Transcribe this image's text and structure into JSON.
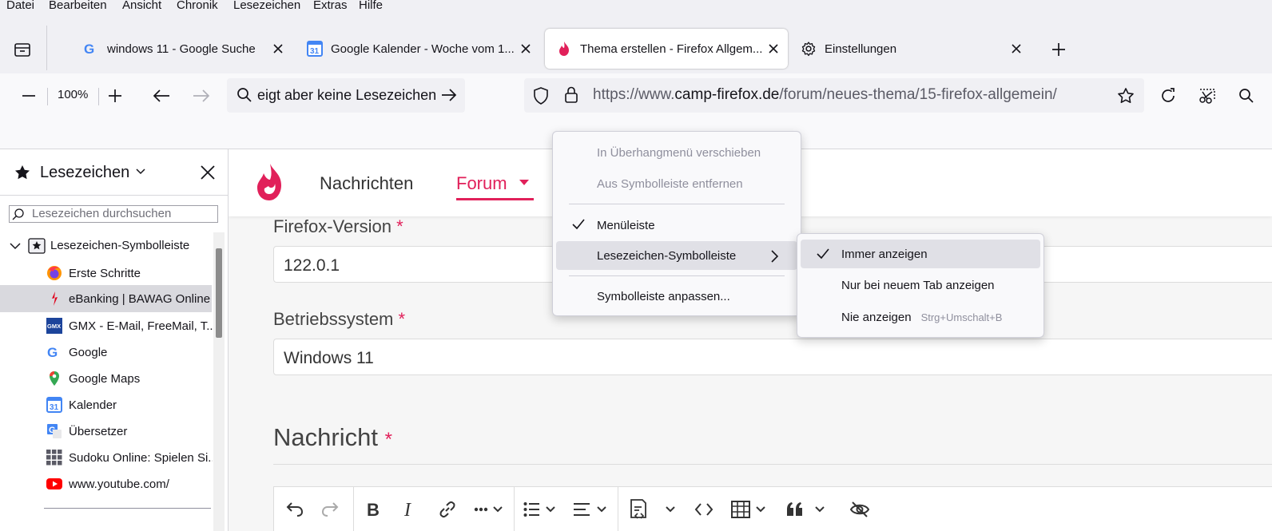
{
  "menubar": [
    "Datei",
    "Bearbeiten",
    "Ansicht",
    "Chronik",
    "Lesezeichen",
    "Extras",
    "Hilfe"
  ],
  "tabs": [
    {
      "title": "windows 11 - Google Suche",
      "icon": "google-icon"
    },
    {
      "title": "Google Kalender - Woche vom 1...",
      "icon": "calendar-icon"
    },
    {
      "title": "Thema erstellen - Firefox Allgem...",
      "icon": "camp-firefox-icon",
      "active": true
    },
    {
      "title": "Einstellungen",
      "icon": "gear-icon"
    }
  ],
  "toolbar": {
    "zoom": "100%",
    "search_text": "eigt aber keine Lesezeichen",
    "url_prefix": "https://www.",
    "url_domain": "camp-firefox.de",
    "url_path": "/forum/neues-thema/15-firefox-allgemein/"
  },
  "sidebar": {
    "title": "Lesezeichen",
    "search_placeholder": "Lesezeichen durchsuchen",
    "folder": "Lesezeichen-Symbolleiste",
    "items": [
      "Erste Schritte",
      "eBanking | BAWAG Online",
      "GMX - E-Mail, FreeMail, T...",
      "Google",
      "Google Maps",
      "Kalender",
      "Übersetzer",
      "Sudoku Online: Spielen Si...",
      "www.youtube.com/"
    ]
  },
  "site": {
    "nav_news": "Nachrichten",
    "nav_forum": "Forum",
    "label_version": "Firefox-Version",
    "value_version": "122.0.1",
    "label_os": "Betriebssystem",
    "value_os": "Windows 11",
    "label_message": "Nachricht",
    "required": "*"
  },
  "context_menu": {
    "move_overflow": "In Überhangmenü verschieben",
    "remove_toolbar": "Aus Symbolleiste entfernen",
    "menubar": "Menüleiste",
    "bookmarks_toolbar": "Lesezeichen-Symbolleiste",
    "customize": "Symbolleiste anpassen..."
  },
  "submenu": {
    "always": "Immer anzeigen",
    "new_tab": "Nur bei neuem Tab anzeigen",
    "never": "Nie anzeigen",
    "never_shortcut": "Strg+Umschalt+B"
  },
  "colors": {
    "accent": "#e1205a",
    "chrome": "#f0f0f4"
  }
}
